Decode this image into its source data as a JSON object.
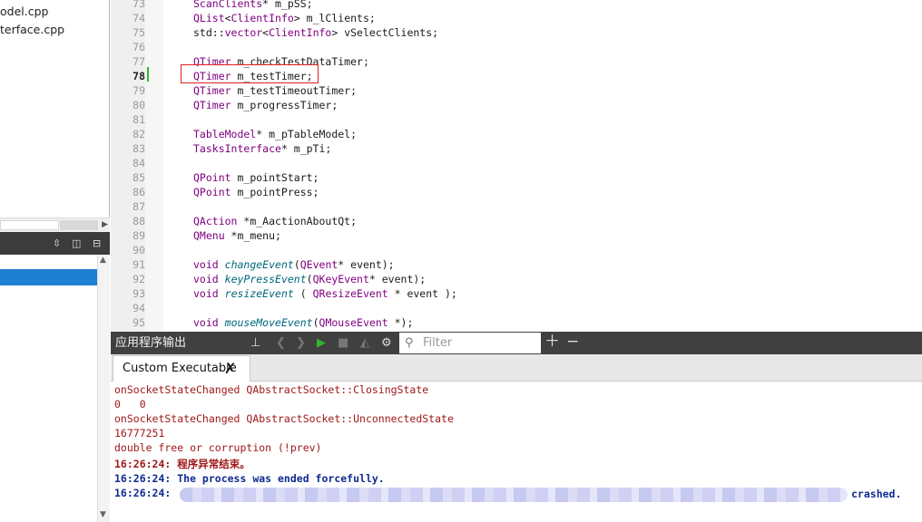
{
  "left_panel": {
    "files": [
      "odel.cpp",
      "terface.cpp"
    ]
  },
  "editor": {
    "current_line": 78,
    "lines": [
      {
        "n": "73",
        "parts": [
          {
            "t": "ScanClients",
            "c": "ty"
          },
          {
            "t": "* m_pSS;",
            "c": ""
          }
        ]
      },
      {
        "n": "74",
        "parts": [
          {
            "t": "QList",
            "c": "ty"
          },
          {
            "t": "<",
            "c": ""
          },
          {
            "t": "ClientInfo",
            "c": "ty"
          },
          {
            "t": "> m_lClients;",
            "c": ""
          }
        ]
      },
      {
        "n": "75",
        "parts": [
          {
            "t": "std::",
            "c": ""
          },
          {
            "t": "vector",
            "c": "ty"
          },
          {
            "t": "<",
            "c": ""
          },
          {
            "t": "ClientInfo",
            "c": "ty"
          },
          {
            "t": "> vSelectClients;",
            "c": ""
          }
        ]
      },
      {
        "n": "76",
        "parts": []
      },
      {
        "n": "77",
        "parts": [
          {
            "t": "QTimer",
            "c": "ty"
          },
          {
            "t": " m_checkTestDataTimer;",
            "c": ""
          }
        ]
      },
      {
        "n": "78",
        "parts": [
          {
            "t": "QTimer",
            "c": "ty"
          },
          {
            "t": " m_testTimer;",
            "c": ""
          }
        ]
      },
      {
        "n": "79",
        "parts": [
          {
            "t": "QTimer",
            "c": "ty"
          },
          {
            "t": " m_testTimeoutTimer;",
            "c": ""
          }
        ]
      },
      {
        "n": "80",
        "parts": [
          {
            "t": "QTimer",
            "c": "ty"
          },
          {
            "t": " m_progressTimer;",
            "c": ""
          }
        ]
      },
      {
        "n": "81",
        "parts": []
      },
      {
        "n": "82",
        "parts": [
          {
            "t": "TableModel",
            "c": "ty"
          },
          {
            "t": "* m_pTableModel;",
            "c": ""
          }
        ]
      },
      {
        "n": "83",
        "parts": [
          {
            "t": "TasksInterface",
            "c": "ty"
          },
          {
            "t": "* m_pTi;",
            "c": ""
          }
        ]
      },
      {
        "n": "84",
        "parts": []
      },
      {
        "n": "85",
        "parts": [
          {
            "t": "QPoint",
            "c": "ty"
          },
          {
            "t": " m_pointStart;",
            "c": ""
          }
        ]
      },
      {
        "n": "86",
        "parts": [
          {
            "t": "QPoint",
            "c": "ty"
          },
          {
            "t": " m_pointPress;",
            "c": ""
          }
        ]
      },
      {
        "n": "87",
        "parts": []
      },
      {
        "n": "88",
        "parts": [
          {
            "t": "QAction",
            "c": "ty"
          },
          {
            "t": " *m_AactionAboutQt;",
            "c": ""
          }
        ]
      },
      {
        "n": "89",
        "parts": [
          {
            "t": "QMenu",
            "c": "ty"
          },
          {
            "t": " *m_menu;",
            "c": ""
          }
        ]
      },
      {
        "n": "90",
        "parts": []
      },
      {
        "n": "91",
        "parts": [
          {
            "t": "void",
            "c": "ty"
          },
          {
            "t": " ",
            "c": ""
          },
          {
            "t": "changeEvent",
            "c": "fn"
          },
          {
            "t": "(",
            "c": ""
          },
          {
            "t": "QEvent",
            "c": "ty"
          },
          {
            "t": "* event);",
            "c": ""
          }
        ]
      },
      {
        "n": "92",
        "parts": [
          {
            "t": "void",
            "c": "ty"
          },
          {
            "t": " ",
            "c": ""
          },
          {
            "t": "keyPressEvent",
            "c": "fn"
          },
          {
            "t": "(",
            "c": ""
          },
          {
            "t": "QKeyEvent",
            "c": "ty"
          },
          {
            "t": "* event);",
            "c": ""
          }
        ]
      },
      {
        "n": "93",
        "parts": [
          {
            "t": "void",
            "c": "ty"
          },
          {
            "t": " ",
            "c": ""
          },
          {
            "t": "resizeEvent",
            "c": "fn"
          },
          {
            "t": " ( ",
            "c": ""
          },
          {
            "t": "QResizeEvent",
            "c": "ty"
          },
          {
            "t": " * event );",
            "c": ""
          }
        ]
      },
      {
        "n": "94",
        "parts": []
      },
      {
        "n": "95",
        "parts": [
          {
            "t": "void",
            "c": "ty"
          },
          {
            "t": " ",
            "c": ""
          },
          {
            "t": "mouseMoveEvent",
            "c": "fn"
          },
          {
            "t": "(",
            "c": ""
          },
          {
            "t": "QMouseEvent",
            "c": "ty"
          },
          {
            "t": " *);",
            "c": ""
          }
        ]
      }
    ]
  },
  "output_pane": {
    "title": "应用程序输出",
    "filter_placeholder": "Filter",
    "tab_label": "Custom Executable",
    "tab_close": "✗",
    "lines": [
      {
        "text": "onSocketStateChanged QAbstractSocket::ClosingState",
        "style": "red"
      },
      {
        "text": "0   0",
        "style": "red"
      },
      {
        "text": "onSocketStateChanged QAbstractSocket::UnconnectedState",
        "style": "red"
      },
      {
        "text": "16777251",
        "style": "red"
      },
      {
        "text": "double free or corruption (!prev)",
        "style": "red"
      },
      {
        "text": "16:26:24: 程序异常结束。",
        "style": "bred"
      },
      {
        "text": "16:26:24: The process was ended forcefully.",
        "style": "blue"
      },
      {
        "text": "16:26:24:",
        "style": "blue"
      }
    ],
    "crashed_suffix": "crashed."
  },
  "icons": {
    "toolbar": [
      "attach-icon",
      "prev-icon",
      "next-icon",
      "run-icon",
      "stop-icon",
      "attach-debugger-icon",
      "settings-icon",
      "zoom-in-icon",
      "zoom-out-icon"
    ]
  },
  "colors": {
    "type": "#800080",
    "function": "#00677c",
    "error": "#a01818",
    "info": "#0f2b91",
    "run": "#2fb52f",
    "highlight_box": "#e02020"
  }
}
